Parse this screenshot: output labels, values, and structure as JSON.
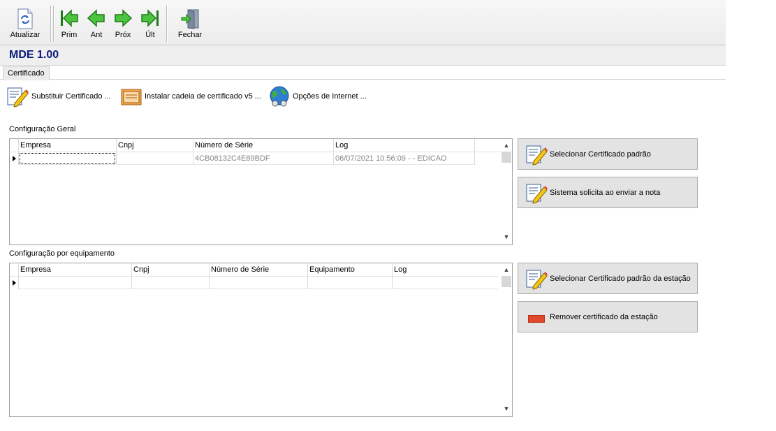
{
  "toolbar": {
    "refresh_label": "Atualizar",
    "first_label": "Prim",
    "prev_label": "Ant",
    "next_label": "Próx",
    "last_label": "Últ",
    "close_label": "Fechar"
  },
  "title": "MDE 1.00",
  "tab": {
    "label": "Certificado"
  },
  "actions": {
    "replace_cert": "Substituir Certificado ...",
    "install_chain": "Instalar cadeia de certificado v5 ...",
    "internet_options": "Opções de Internet ..."
  },
  "general": {
    "label": "Configuração Geral",
    "columns": [
      "Empresa",
      "Cnpj",
      "Número de Série",
      "Log"
    ],
    "rows": [
      {
        "empresa": "",
        "cnpj": "",
        "serie": "4CB08132C4E89BDF",
        "log": "06/07/2021 10:56:09 -  - EDICAO"
      }
    ],
    "select_default_button": "Selecionar Certificado padrão",
    "ask_on_send_button": "Sistema solicita ao enviar a nota"
  },
  "equipment": {
    "label": "Configuração por equipamento",
    "columns": [
      "Empresa",
      "Cnpj",
      "Número de Série",
      "Equipamento",
      "Log"
    ],
    "select_station_button": "Selecionar Certificado padrão da estação",
    "remove_station_button": "Remover certificado da estação"
  },
  "colors": {
    "title": "#0a1a7a",
    "remove_icon": "#e0482b",
    "nav_arrow": "#2fa82a"
  }
}
